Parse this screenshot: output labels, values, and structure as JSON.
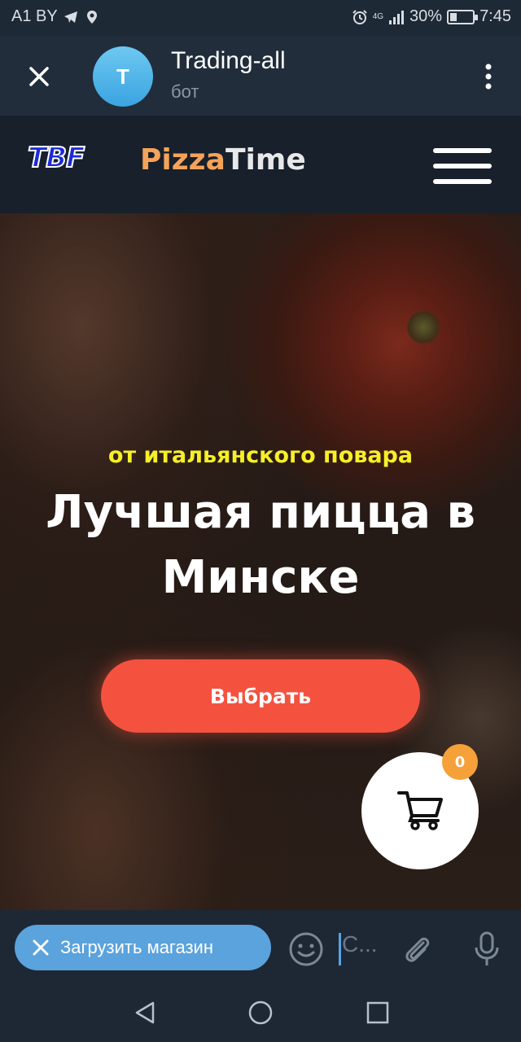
{
  "status_bar": {
    "carrier": "A1 BY",
    "network": "4G",
    "battery": "30%",
    "battery_level": 0.3,
    "time": "7:45"
  },
  "header": {
    "avatar_letter": "T",
    "title": "Trading-all",
    "subtitle": "бот"
  },
  "site": {
    "logo_tbf": "TBF",
    "logo_pizza_part1": "Pizza",
    "logo_pizza_part2": "Time",
    "hero_subtitle": "от итальянского повара",
    "hero_title": "Лучшая пицца в Минске",
    "cta_label": "Выбрать",
    "cart_count": "0",
    "colors": {
      "cta": "#f4523f",
      "subtitle": "#f6ef27",
      "logo_pizza": "#f5a25a",
      "badge": "#f6a03a"
    }
  },
  "input_bar": {
    "load_shop_label": "Загрузить магазин",
    "input_placeholder": "С..."
  },
  "icons": [
    "close-icon",
    "more-vert-icon",
    "menu-icon",
    "cart-icon",
    "emoji-icon",
    "paperclip-icon",
    "mic-icon",
    "back-icon",
    "home-icon",
    "recent-apps-icon"
  ]
}
